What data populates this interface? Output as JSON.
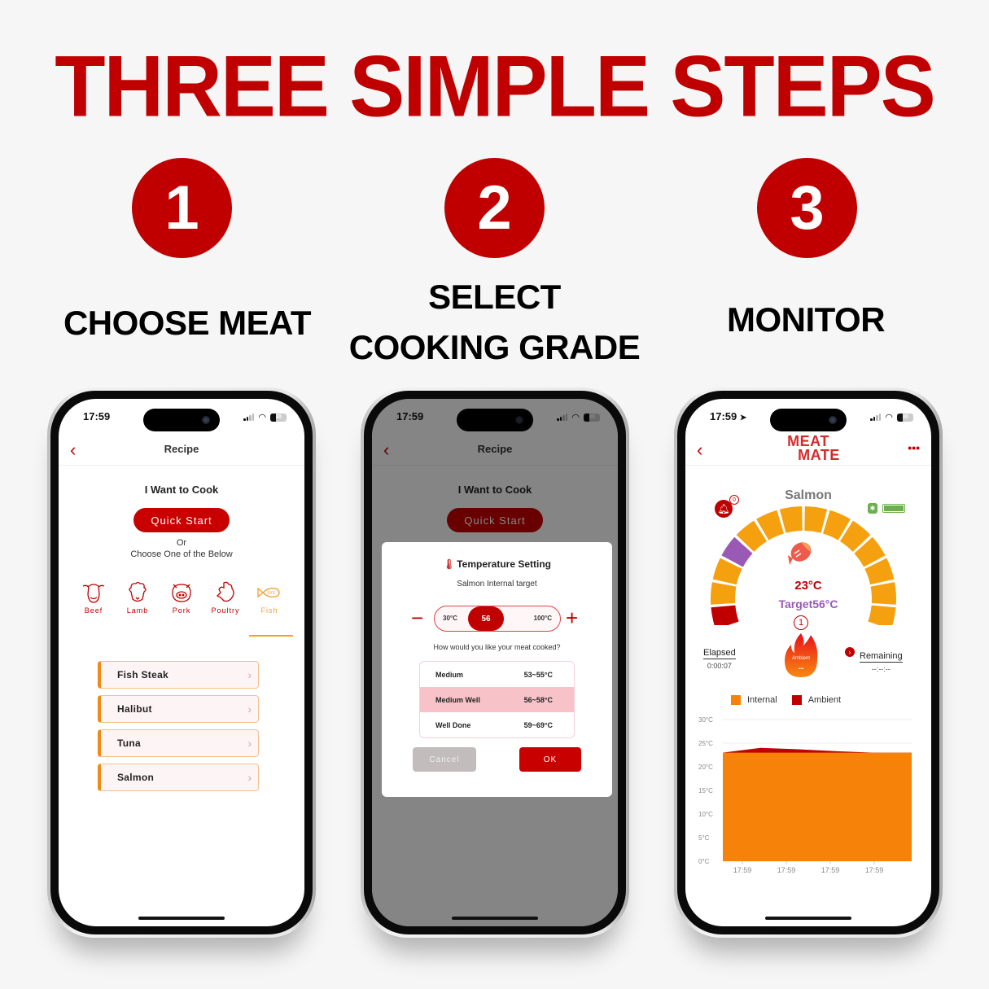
{
  "headline": "THREE SIMPLE STEPS",
  "steps": [
    {
      "number": "1",
      "label_lines": [
        "CHOOSE MEAT"
      ]
    },
    {
      "number": "2",
      "label_lines": [
        "SELECT",
        "COOKING GRADE"
      ]
    },
    {
      "number": "3",
      "label_lines": [
        "MONITOR"
      ]
    }
  ],
  "colors": {
    "brand_red": "#c00000",
    "orange": "#f5a00f",
    "purple": "#9b59b6",
    "chart_internal": "#f7820a",
    "chart_ambient": "#c00000"
  },
  "status_bar": {
    "time": "17:59",
    "battery": "30"
  },
  "phone1": {
    "nav_title": "Recipe",
    "back_icon": "chevron-left-icon",
    "cook_title": "I Want to Cook",
    "quick_start": "Quick Start",
    "or_text": "Or",
    "choose_text": "Choose One of the Below",
    "categories": [
      {
        "label": "Beef",
        "icon": "cow-icon"
      },
      {
        "label": "Lamb",
        "icon": "sheep-icon"
      },
      {
        "label": "Pork",
        "icon": "pig-icon"
      },
      {
        "label": "Poultry",
        "icon": "chicken-icon"
      },
      {
        "label": "Fish",
        "icon": "fish-icon",
        "active": true
      }
    ],
    "meats": [
      "Fish Steak",
      "Halibut",
      "Tuna",
      "Salmon"
    ]
  },
  "phone2": {
    "nav_title": "Recipe",
    "cook_title": "I Want to Cook",
    "quick_start": "Quick Start",
    "modal": {
      "title": "Temperature Setting",
      "subtitle": "Salmon Internal target",
      "slider_min": "30°C",
      "slider_max": "100°C",
      "slider_value": "56",
      "question": "How would you like your meat cooked?",
      "grades": [
        {
          "name": "Medium",
          "range": "53~55°C"
        },
        {
          "name": "Medium Well",
          "range": "56~58°C",
          "selected": true
        },
        {
          "name": "Well Done",
          "range": "59~69°C"
        }
      ],
      "cancel": "Cancel",
      "ok": "OK"
    }
  },
  "phone3": {
    "logo_line1": "MEAT",
    "logo_line2": "MATE",
    "more": "•••",
    "food_name": "Salmon",
    "bell_badge": "0",
    "current_temp": "23°C",
    "target_temp": "Target56°C",
    "probe_number": "1",
    "elapsed_label": "Elapsed",
    "elapsed_value": "0:00:07",
    "remaining_label": "Remaining",
    "remaining_value": "--:--:--",
    "ambient_label": "Ambient",
    "ambient_value": "--",
    "gauge": {
      "segments": 14,
      "current_segment_index": 0,
      "target_segment_index": 3
    }
  },
  "chart_data": {
    "type": "area",
    "title": "",
    "xlabel": "",
    "ylabel": "",
    "ylim": [
      0,
      30
    ],
    "yticks": [
      "0°C",
      "5°C",
      "10°C",
      "15°C",
      "20°C",
      "25°C",
      "30°C"
    ],
    "categories": [
      "17:59",
      "17:59",
      "17:59",
      "17:59"
    ],
    "legend": [
      "Internal",
      "Ambient"
    ],
    "legend_position": "top",
    "series": [
      {
        "name": "Ambient",
        "values": [
          23,
          24,
          23.7,
          23.3,
          23,
          23
        ]
      },
      {
        "name": "Internal",
        "values": [
          23,
          23,
          23,
          23,
          23,
          23
        ]
      }
    ]
  }
}
